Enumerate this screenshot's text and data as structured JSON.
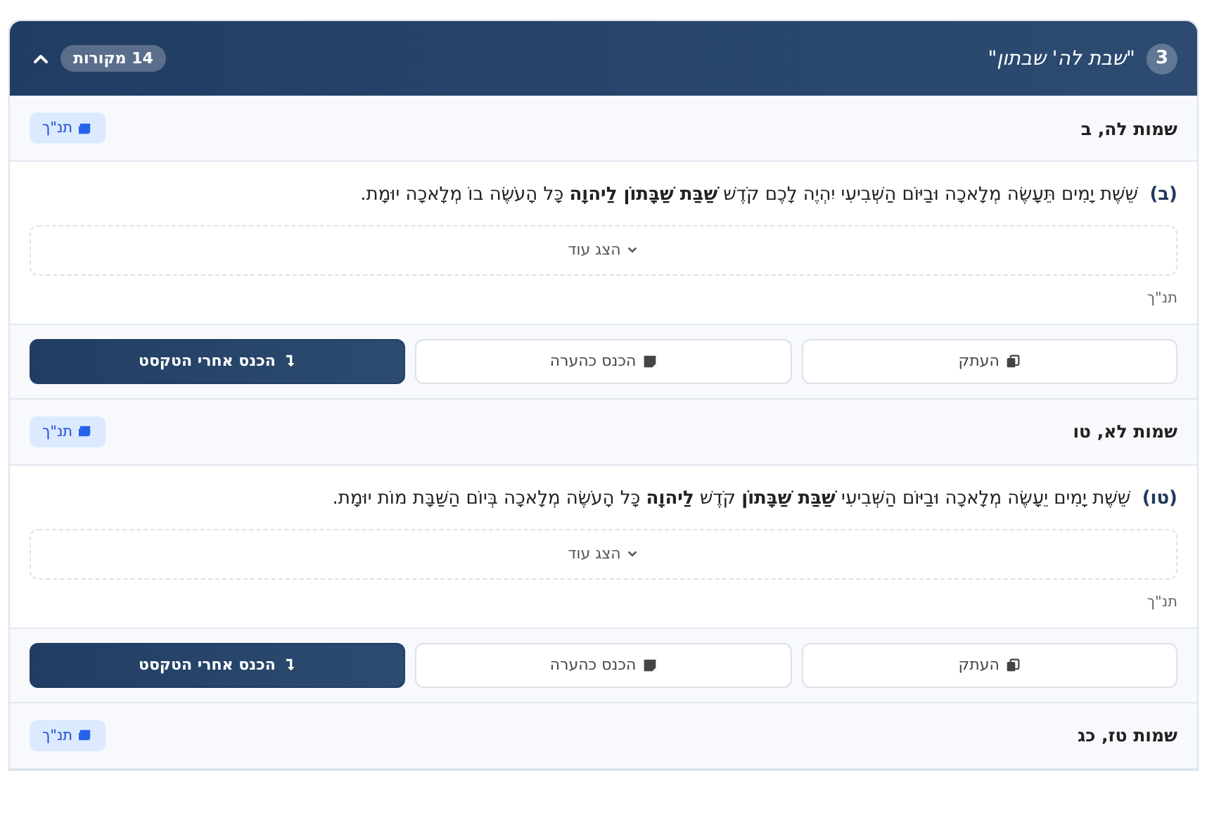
{
  "section": {
    "number": "3",
    "title": "\"שבת לה' שבתון\"",
    "count_badge": "14 מקורות",
    "expanded": true
  },
  "sources": [
    {
      "reference": "שמות לה, ב",
      "tag": "תנ\"ך",
      "verse_marker": "(ב)",
      "verse": "שֵׁשֶׁת יָמִים תֵּעָשֶׂה מְלָאכָה וּבַיּוֹם הַשְּׁבִיעִי יִהְיֶה לָכֶם קֹדֶשׁ **שַׁבַּת שַׁבָּתוֹן לַיהוָה** כָּל הָעֹשֶׂה בוֹ מְלָאכָה יוּמָת.",
      "show_more": "הצג עוד",
      "category": "תנ\"ך",
      "actions": [
        "העתק",
        "הכנס כהערה",
        "הכנס אחרי הטקסט"
      ]
    },
    {
      "reference": "שמות לא, טו",
      "tag": "תנ\"ך",
      "verse_marker": "(טו)",
      "verse": "שֵׁשֶׁת יָמִים יֵעָשֶׂה מְלָאכָה וּבַיּוֹם הַשְּׁבִיעִי **שַׁבַּת שַׁבָּתוֹן** קֹדֶשׁ **לַיהוָה** כָּל הָעֹשֶׂה מְלָאכָה בְּיוֹם הַשַּׁבָּת מוֹת יוּמָת.",
      "show_more": "הצג עוד",
      "category": "תנ\"ך",
      "actions": [
        "העתק",
        "הכנס כהערה",
        "הכנס אחרי הטקסט"
      ]
    },
    {
      "reference": "שמות טז, כג",
      "tag": "תנ\"ך"
    }
  ]
}
